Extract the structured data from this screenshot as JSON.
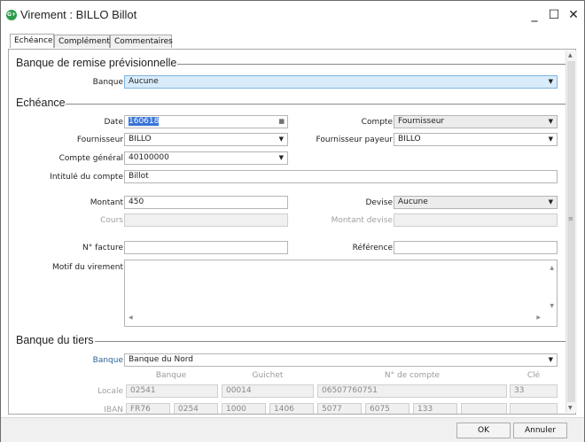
{
  "window": {
    "title": "Virement : BILLO Billot",
    "logo": "G+"
  },
  "tabs": [
    {
      "label": "Echéance"
    },
    {
      "label": "Complément"
    },
    {
      "label": "Commentaires"
    }
  ],
  "sections": {
    "banque_remise": "Banque de remise prévisionnelle",
    "echeance": "Echéance",
    "banque_tiers": "Banque du tiers"
  },
  "banque_remise": {
    "label": "Banque",
    "value": "Aucune"
  },
  "echeance": {
    "date": {
      "label": "Date",
      "value": "160618"
    },
    "compte": {
      "label": "Compte",
      "value": "Fournisseur"
    },
    "fournisseur": {
      "label": "Fournisseur",
      "value": "BILLO"
    },
    "fournisseur_payeur": {
      "label": "Fournisseur payeur",
      "value": "BILLO"
    },
    "compte_general": {
      "label": "Compte général",
      "value": "40100000"
    },
    "intitule": {
      "label": "Intitulé du compte",
      "value": "Billot"
    },
    "montant": {
      "label": "Montant",
      "value": "450"
    },
    "devise": {
      "label": "Devise",
      "value": "Aucune"
    },
    "cours": {
      "label": "Cours",
      "value": ""
    },
    "montant_devise": {
      "label": "Montant devise",
      "value": ""
    },
    "facture": {
      "label": "N° facture",
      "value": ""
    },
    "reference": {
      "label": "Référence",
      "value": ""
    },
    "motif": {
      "label": "Motif du virement",
      "value": ""
    }
  },
  "banque_tiers": {
    "banque": {
      "label": "Banque",
      "value": "Banque du Nord"
    },
    "headers": {
      "banque": "Banque",
      "guichet": "Guichet",
      "compte": "N° de compte",
      "cle": "Clé"
    },
    "locale": {
      "label": "Locale",
      "banque": "02541",
      "guichet": "00014",
      "compte": "06507760751",
      "cle": "33"
    },
    "iban": {
      "label": "IBAN",
      "parts": [
        "FR76",
        "0254",
        "1000",
        "1406",
        "5077",
        "6075",
        "133",
        "",
        ""
      ]
    }
  },
  "buttons": {
    "ok": "OK",
    "cancel": "Annuler"
  },
  "icons": {
    "minimize": "_",
    "maximize": "☐",
    "close": "✕",
    "dropdown": "▼",
    "calendar": "▦"
  },
  "colors": {
    "accent": "#3874d8",
    "combo_highlight": "#d9ecfb",
    "logo": "#2e9b4a"
  }
}
